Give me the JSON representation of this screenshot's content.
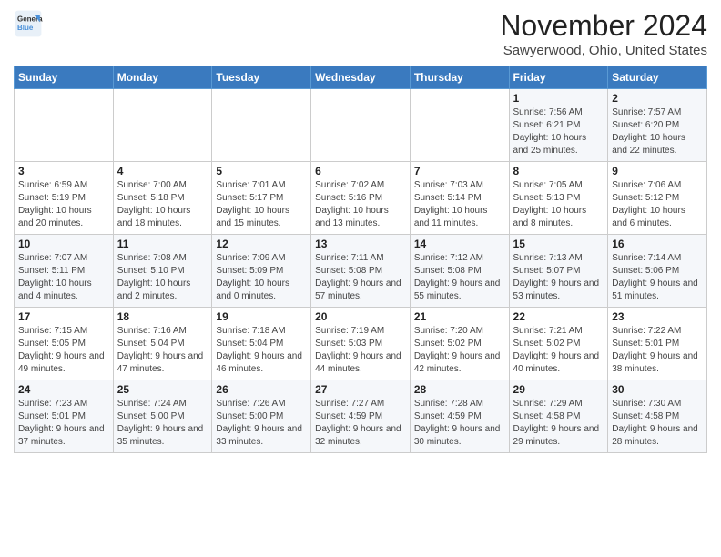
{
  "header": {
    "logo_line1": "General",
    "logo_line2": "Blue",
    "month": "November 2024",
    "location": "Sawyerwood, Ohio, United States"
  },
  "weekdays": [
    "Sunday",
    "Monday",
    "Tuesday",
    "Wednesday",
    "Thursday",
    "Friday",
    "Saturday"
  ],
  "weeks": [
    [
      {
        "day": "",
        "info": ""
      },
      {
        "day": "",
        "info": ""
      },
      {
        "day": "",
        "info": ""
      },
      {
        "day": "",
        "info": ""
      },
      {
        "day": "",
        "info": ""
      },
      {
        "day": "1",
        "info": "Sunrise: 7:56 AM\nSunset: 6:21 PM\nDaylight: 10 hours and 25 minutes."
      },
      {
        "day": "2",
        "info": "Sunrise: 7:57 AM\nSunset: 6:20 PM\nDaylight: 10 hours and 22 minutes."
      }
    ],
    [
      {
        "day": "3",
        "info": "Sunrise: 6:59 AM\nSunset: 5:19 PM\nDaylight: 10 hours and 20 minutes."
      },
      {
        "day": "4",
        "info": "Sunrise: 7:00 AM\nSunset: 5:18 PM\nDaylight: 10 hours and 18 minutes."
      },
      {
        "day": "5",
        "info": "Sunrise: 7:01 AM\nSunset: 5:17 PM\nDaylight: 10 hours and 15 minutes."
      },
      {
        "day": "6",
        "info": "Sunrise: 7:02 AM\nSunset: 5:16 PM\nDaylight: 10 hours and 13 minutes."
      },
      {
        "day": "7",
        "info": "Sunrise: 7:03 AM\nSunset: 5:14 PM\nDaylight: 10 hours and 11 minutes."
      },
      {
        "day": "8",
        "info": "Sunrise: 7:05 AM\nSunset: 5:13 PM\nDaylight: 10 hours and 8 minutes."
      },
      {
        "day": "9",
        "info": "Sunrise: 7:06 AM\nSunset: 5:12 PM\nDaylight: 10 hours and 6 minutes."
      }
    ],
    [
      {
        "day": "10",
        "info": "Sunrise: 7:07 AM\nSunset: 5:11 PM\nDaylight: 10 hours and 4 minutes."
      },
      {
        "day": "11",
        "info": "Sunrise: 7:08 AM\nSunset: 5:10 PM\nDaylight: 10 hours and 2 minutes."
      },
      {
        "day": "12",
        "info": "Sunrise: 7:09 AM\nSunset: 5:09 PM\nDaylight: 10 hours and 0 minutes."
      },
      {
        "day": "13",
        "info": "Sunrise: 7:11 AM\nSunset: 5:08 PM\nDaylight: 9 hours and 57 minutes."
      },
      {
        "day": "14",
        "info": "Sunrise: 7:12 AM\nSunset: 5:08 PM\nDaylight: 9 hours and 55 minutes."
      },
      {
        "day": "15",
        "info": "Sunrise: 7:13 AM\nSunset: 5:07 PM\nDaylight: 9 hours and 53 minutes."
      },
      {
        "day": "16",
        "info": "Sunrise: 7:14 AM\nSunset: 5:06 PM\nDaylight: 9 hours and 51 minutes."
      }
    ],
    [
      {
        "day": "17",
        "info": "Sunrise: 7:15 AM\nSunset: 5:05 PM\nDaylight: 9 hours and 49 minutes."
      },
      {
        "day": "18",
        "info": "Sunrise: 7:16 AM\nSunset: 5:04 PM\nDaylight: 9 hours and 47 minutes."
      },
      {
        "day": "19",
        "info": "Sunrise: 7:18 AM\nSunset: 5:04 PM\nDaylight: 9 hours and 46 minutes."
      },
      {
        "day": "20",
        "info": "Sunrise: 7:19 AM\nSunset: 5:03 PM\nDaylight: 9 hours and 44 minutes."
      },
      {
        "day": "21",
        "info": "Sunrise: 7:20 AM\nSunset: 5:02 PM\nDaylight: 9 hours and 42 minutes."
      },
      {
        "day": "22",
        "info": "Sunrise: 7:21 AM\nSunset: 5:02 PM\nDaylight: 9 hours and 40 minutes."
      },
      {
        "day": "23",
        "info": "Sunrise: 7:22 AM\nSunset: 5:01 PM\nDaylight: 9 hours and 38 minutes."
      }
    ],
    [
      {
        "day": "24",
        "info": "Sunrise: 7:23 AM\nSunset: 5:01 PM\nDaylight: 9 hours and 37 minutes."
      },
      {
        "day": "25",
        "info": "Sunrise: 7:24 AM\nSunset: 5:00 PM\nDaylight: 9 hours and 35 minutes."
      },
      {
        "day": "26",
        "info": "Sunrise: 7:26 AM\nSunset: 5:00 PM\nDaylight: 9 hours and 33 minutes."
      },
      {
        "day": "27",
        "info": "Sunrise: 7:27 AM\nSunset: 4:59 PM\nDaylight: 9 hours and 32 minutes."
      },
      {
        "day": "28",
        "info": "Sunrise: 7:28 AM\nSunset: 4:59 PM\nDaylight: 9 hours and 30 minutes."
      },
      {
        "day": "29",
        "info": "Sunrise: 7:29 AM\nSunset: 4:58 PM\nDaylight: 9 hours and 29 minutes."
      },
      {
        "day": "30",
        "info": "Sunrise: 7:30 AM\nSunset: 4:58 PM\nDaylight: 9 hours and 28 minutes."
      }
    ]
  ]
}
